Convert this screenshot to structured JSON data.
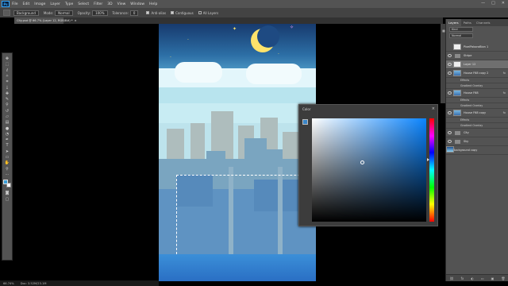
{
  "app": {
    "logo_text": "Ps"
  },
  "menu": [
    "File",
    "Edit",
    "Image",
    "Layer",
    "Type",
    "Select",
    "Filter",
    "3D",
    "View",
    "Window",
    "Help"
  ],
  "window_controls": [
    "—",
    "□",
    "✕"
  ],
  "options": {
    "sample_value": "Background",
    "mode_label": "Mode:",
    "mode_value": "Normal",
    "opacity_label": "Opacity:",
    "opacity_value": "100%",
    "tolerance_label": "Tolerance:",
    "tolerance_value": "0",
    "anti_alias_label": "Anti-alias",
    "contiguous_label": "Contiguous",
    "all_layers_label": "All Layers"
  },
  "document_tab": {
    "title": "City.psd @ 66.7% (Layer 12, RGB/8#) *",
    "close": "×"
  },
  "color_panel": {
    "title": "Color",
    "close": "×"
  },
  "colors": {
    "foreground": "#3b9fd7",
    "background": "#ffffff",
    "picker_hue": "#0a84ff"
  },
  "layers_panel": {
    "tabs": [
      "Layers",
      "Paths",
      "Channels"
    ],
    "kind_label": "Kind",
    "blend_mode": "Normal",
    "layers": [
      {
        "name": "PixelPaboraBion 1",
        "visible": false,
        "type": "image"
      },
      {
        "name": "Stripe",
        "visible": true,
        "type": "folder"
      },
      {
        "name": "Layer 12",
        "visible": true,
        "type": "image",
        "selected": true
      },
      {
        "name": "House F68 copy 2",
        "visible": true,
        "type": "city",
        "fx": "fx"
      },
      {
        "name": "House F68",
        "visible": true,
        "type": "city",
        "fx": "fx"
      },
      {
        "name": "House F68 copy",
        "visible": true,
        "type": "city",
        "fx": "fx"
      },
      {
        "name": "City",
        "visible": true,
        "type": "folder"
      },
      {
        "name": "Sky",
        "visible": true,
        "type": "folder"
      },
      {
        "name": "Background copy",
        "visible": true,
        "type": "sky"
      }
    ],
    "effects_label": "Effects",
    "gradient_overlay_label": "Gradient Overlay",
    "bottom_icons": [
      "⛓",
      "fx",
      "◐",
      "▭",
      "▣",
      "🗑"
    ]
  },
  "status": {
    "zoom": "66.74%",
    "doc": "Doc: 3.52M/23.1M"
  }
}
